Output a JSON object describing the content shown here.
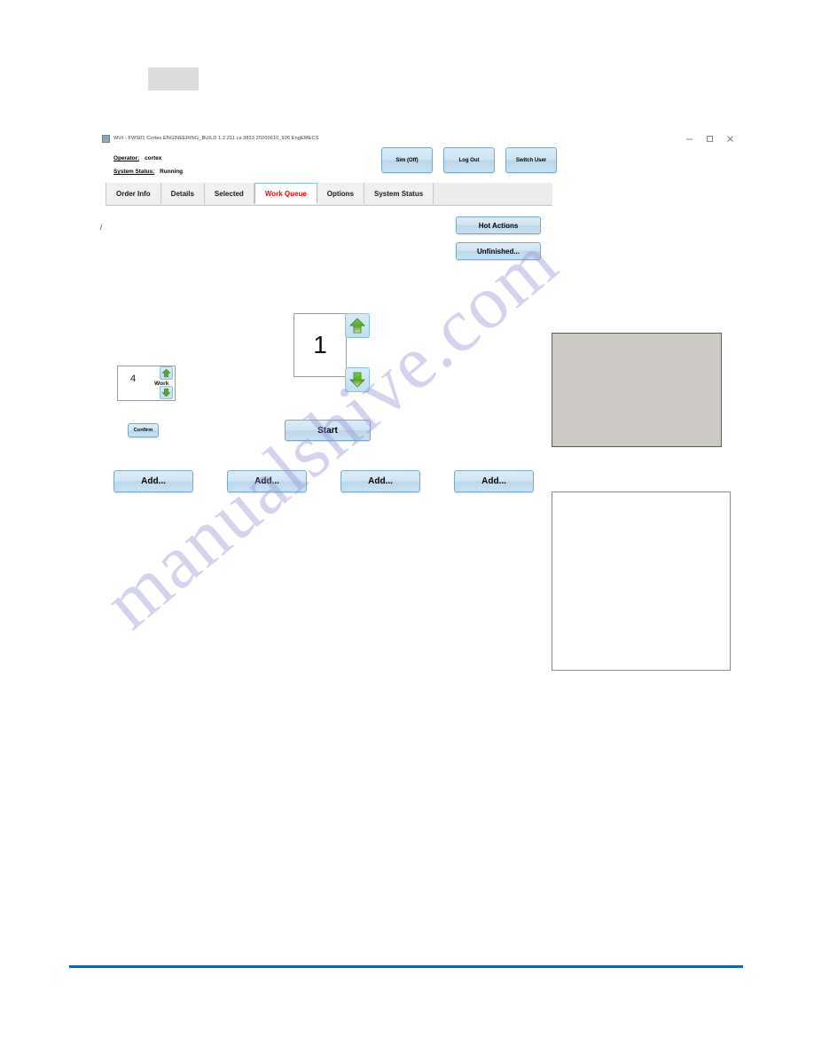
{
  "page": {
    "watermark_text": "manualshive.com"
  },
  "window": {
    "title": "WUI - FWS01 Cortex ENGINEERING_BUILD 1.2.211 cs 3833  20200610_926 EngEMECS",
    "controls": {
      "minimize": "minimize-icon",
      "maximize": "maximize-icon",
      "close": "close-icon"
    }
  },
  "header": {
    "operator_label": "Operator:",
    "operator_value": "cortex",
    "status_label": "System Status:",
    "status_value": "Running",
    "buttons": [
      {
        "label": "Sim (Off)",
        "name": "sim-toggle-button"
      },
      {
        "label": "Log Out",
        "name": "log-out-button"
      },
      {
        "label": "Switch User",
        "name": "switch-user-button"
      }
    ]
  },
  "tabs": [
    {
      "label": "Order Info",
      "active": false
    },
    {
      "label": "Details",
      "active": false
    },
    {
      "label": "Selected",
      "active": false
    },
    {
      "label": "Work Queue",
      "active": true
    },
    {
      "label": "Options",
      "active": false
    },
    {
      "label": "System Status",
      "active": false
    }
  ],
  "work_queue": {
    "hot_actions_label": "Hot Actions",
    "unfinished_label": "Unfinished...",
    "counter_value": "1",
    "counter_up_icon": "arrow-up-icon",
    "counter_down_icon": "arrow-down-icon",
    "work_field_prefix": "/",
    "work_field_value": "4",
    "work_field_label": "Work",
    "work_up_icon": "arrow-up-icon",
    "work_down_icon": "arrow-down-icon",
    "confirm_label": "Confirm",
    "start_label": "Start",
    "add_buttons": [
      {
        "label": "Add..."
      },
      {
        "label": "Add..."
      },
      {
        "label": "Add..."
      },
      {
        "label": "Add..."
      }
    ]
  },
  "colors": {
    "accent_blue": "#1067a4",
    "active_tab_text": "#ff0000",
    "button_face": "#cfe4f3",
    "arrow_green": "#5aa832",
    "panel_gray": "#cdc9c4"
  }
}
